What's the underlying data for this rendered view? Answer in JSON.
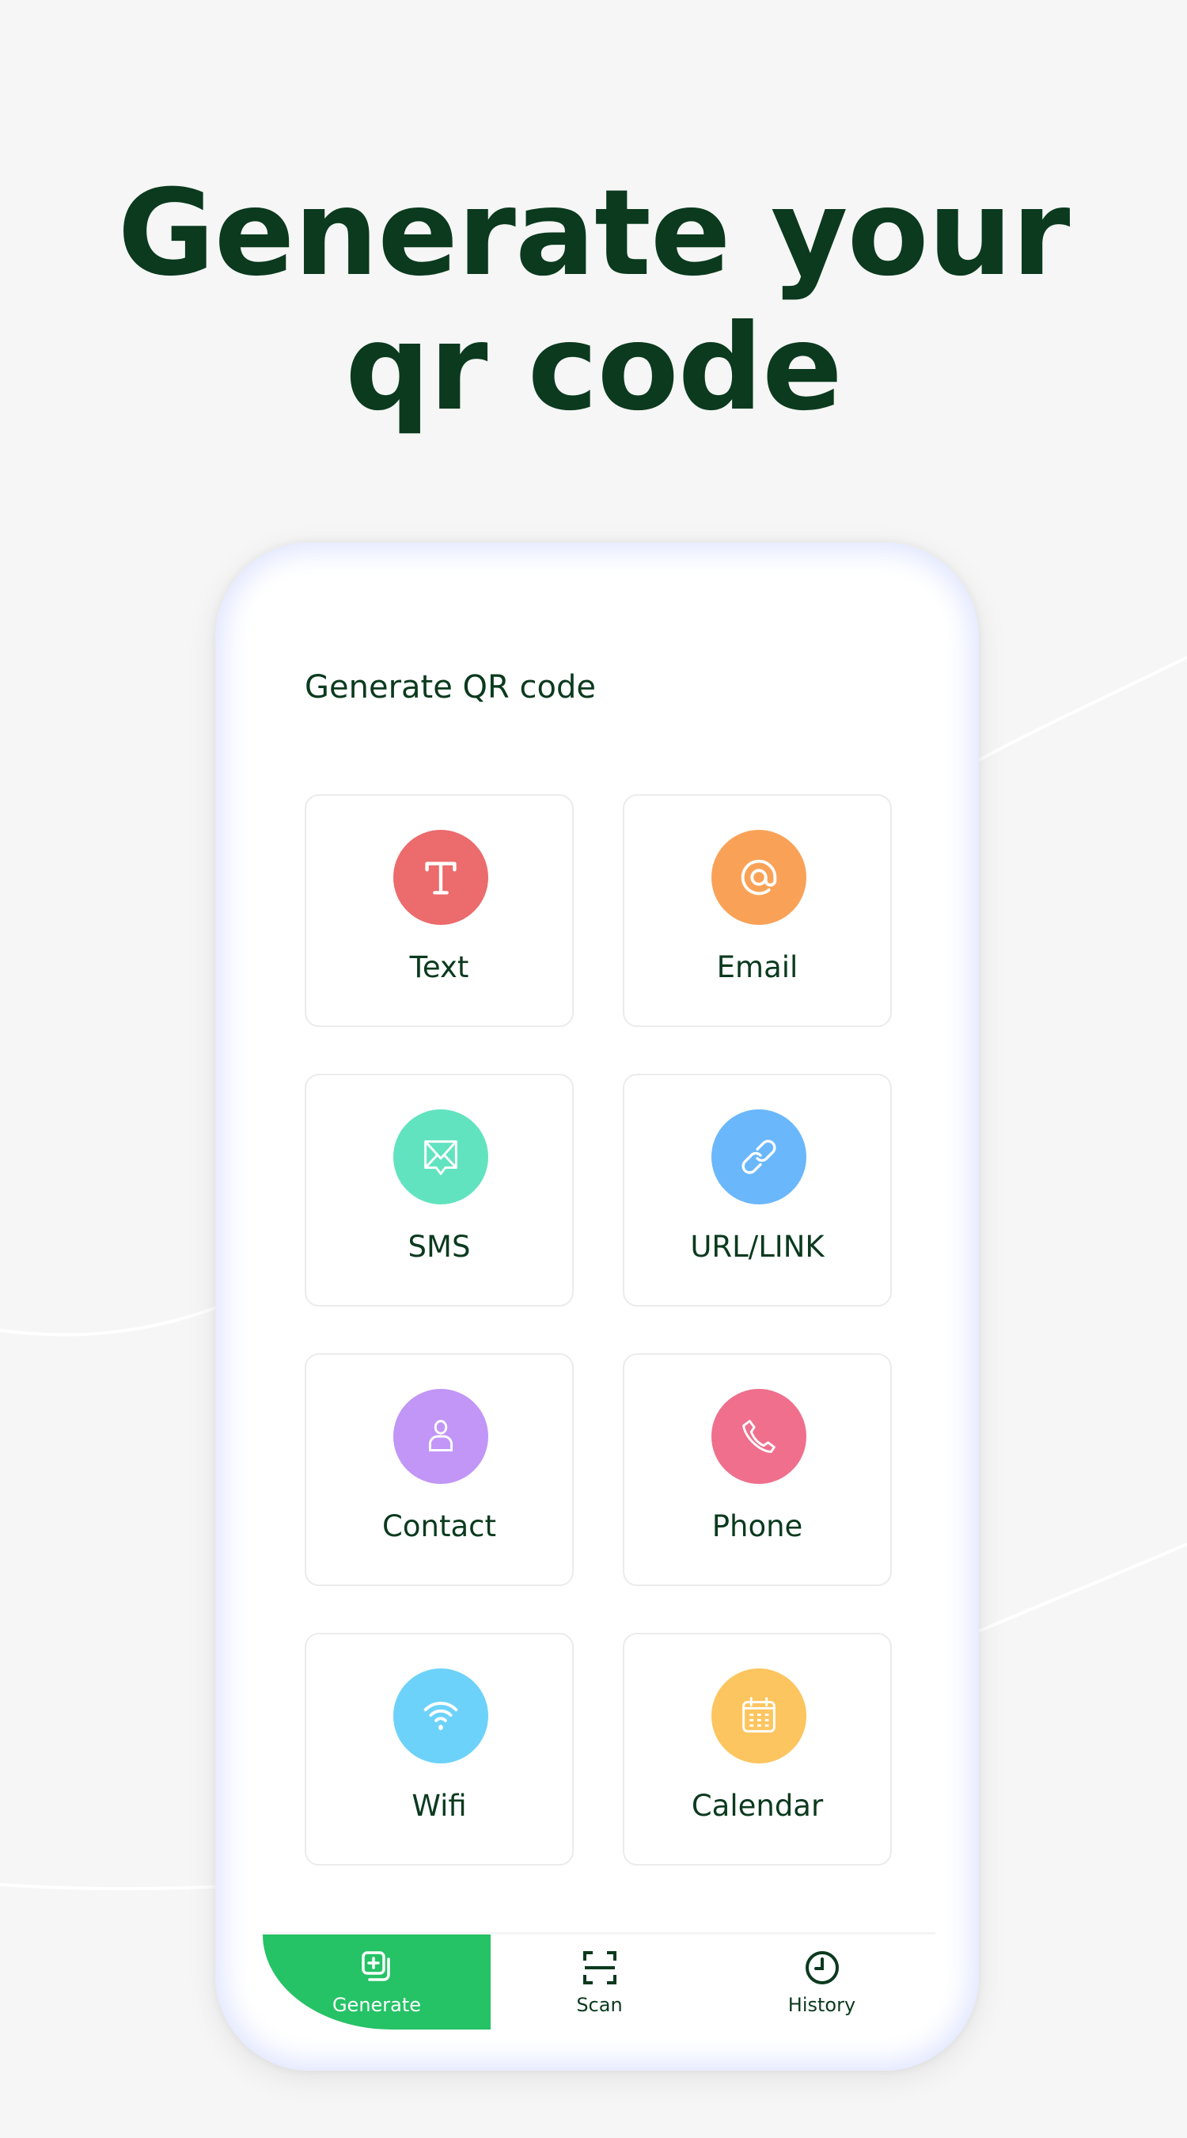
{
  "hero": {
    "line1": "Generate your",
    "line2": "qr code"
  },
  "screen": {
    "title": "Generate QR code",
    "options": [
      {
        "label": "Text",
        "icon": "text-icon",
        "color": "#ec6b6c"
      },
      {
        "label": "Email",
        "icon": "at-sign-icon",
        "color": "#f9a257"
      },
      {
        "label": "SMS",
        "icon": "message-envelope-icon",
        "color": "#62e3c0"
      },
      {
        "label": "URL/LINK",
        "icon": "link-icon",
        "color": "#6ab7fb"
      },
      {
        "label": "Contact",
        "icon": "person-icon",
        "color": "#c196f7"
      },
      {
        "label": "Phone",
        "icon": "phone-icon",
        "color": "#ef6f8d"
      },
      {
        "label": "Wifi",
        "icon": "wifi-icon",
        "color": "#6dd2fa"
      },
      {
        "label": "Calendar",
        "icon": "calendar-icon",
        "color": "#fdc55f"
      }
    ]
  },
  "tabbar": {
    "active": "Generate",
    "accent": "#25c266",
    "items": [
      {
        "label": "Generate",
        "icon": "generate-add-icon"
      },
      {
        "label": "Scan",
        "icon": "scan-frame-icon"
      },
      {
        "label": "History",
        "icon": "clock-icon"
      }
    ]
  }
}
